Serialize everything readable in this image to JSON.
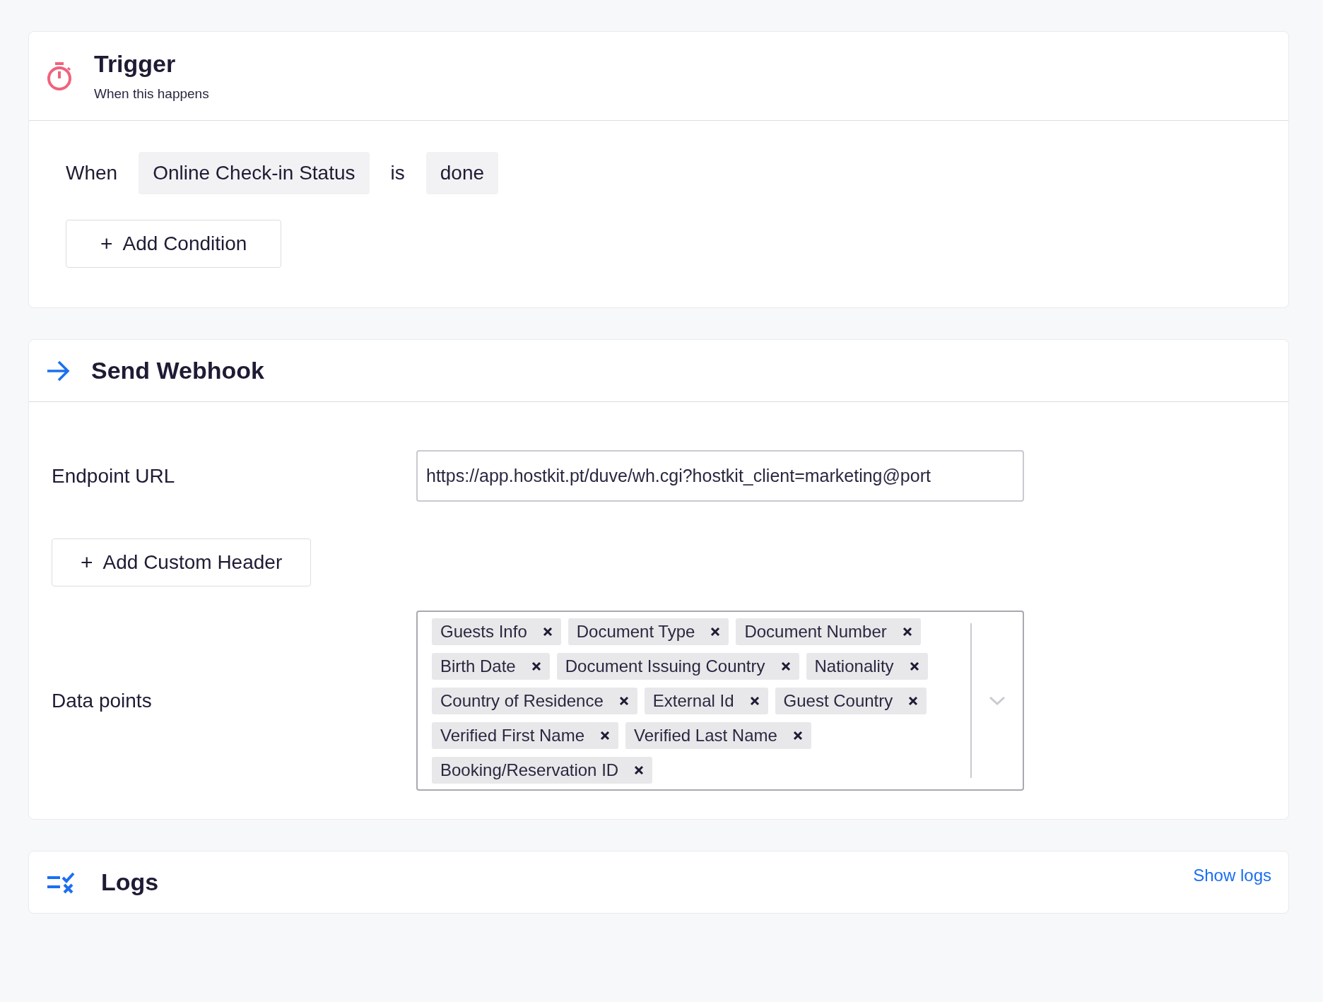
{
  "trigger": {
    "title": "Trigger",
    "subtitle": "When this happens",
    "condition": [
      {
        "kind": "word",
        "text": "When"
      },
      {
        "kind": "chip",
        "text": "Online Check-in Status"
      },
      {
        "kind": "word",
        "text": "is"
      },
      {
        "kind": "chip",
        "text": "done"
      }
    ],
    "add_button": {
      "icon": "+",
      "label": "Add Condition"
    }
  },
  "webhook": {
    "title": "Send Webhook",
    "endpoint": {
      "label": "Endpoint URL",
      "value": "https://app.hostkit.pt/duve/wh.cgi?hostkit_client=marketing@port"
    },
    "add_header_button": {
      "icon": "+",
      "label": "Add Custom Header"
    },
    "data_points": {
      "label": "Data points",
      "tags": [
        {
          "label": "Guests Info"
        },
        {
          "label": "Document Type"
        },
        {
          "label": "Document Number"
        },
        {
          "label": "Birth Date"
        },
        {
          "label": "Document Issuing Country"
        },
        {
          "label": "Nationality"
        },
        {
          "label": "Country of Residence"
        },
        {
          "label": "External Id"
        },
        {
          "label": "Guest Country"
        },
        {
          "label": "Verified First Name"
        },
        {
          "label": "Verified Last Name"
        },
        {
          "label": "Booking/Reservation ID"
        }
      ]
    }
  },
  "logs": {
    "title": "Logs",
    "link": "Show logs"
  }
}
